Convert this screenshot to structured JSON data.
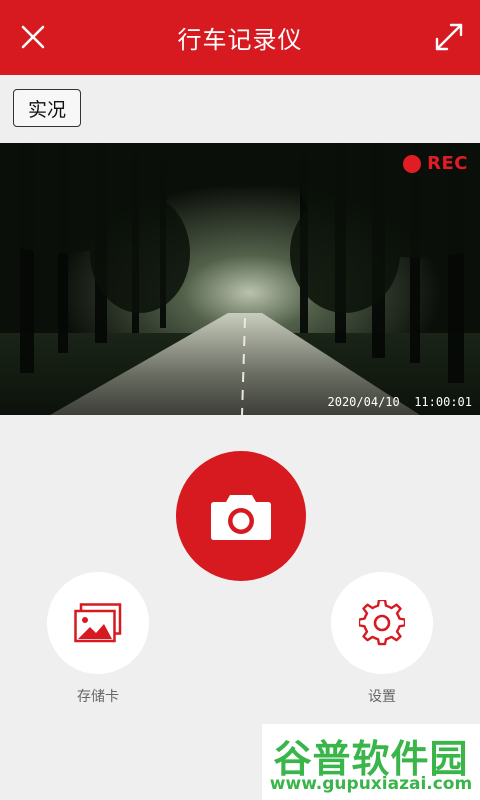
{
  "header": {
    "title": "行车记录仪",
    "close_icon": "close-icon",
    "expand_icon": "expand-icon",
    "background_color": "#d71920"
  },
  "mode_button": {
    "label": "实况"
  },
  "preview": {
    "rec_label": "REC",
    "timestamp": "2020/04/10  11:00:01",
    "rec_color": "#e21c24"
  },
  "controls": {
    "shutter_icon": "camera-icon",
    "sd_card": {
      "label": "存储卡",
      "icon": "gallery-icon"
    },
    "settings": {
      "label": "设置",
      "icon": "gear-icon"
    }
  },
  "watermark": {
    "title": "谷普软件园",
    "url": "www.gupuxiazai.com"
  }
}
